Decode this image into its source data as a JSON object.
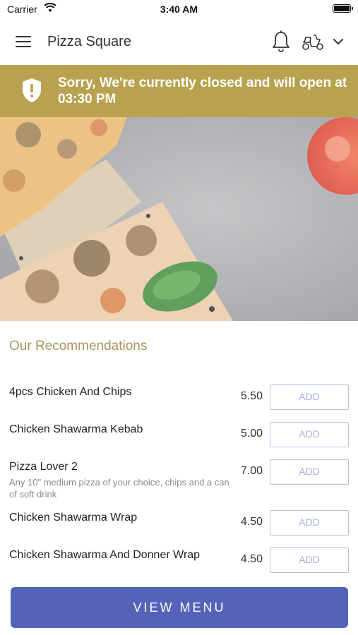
{
  "status_bar": {
    "carrier": "Carrier",
    "time": "3:40 AM"
  },
  "header": {
    "title": "Pizza Square",
    "icons": [
      "menu-icon",
      "bell-icon",
      "delivery-scooter-icon",
      "chevron-down-icon"
    ]
  },
  "banner": {
    "message": "Sorry, We're currently closed and will open at 03:30 PM",
    "icon": "shield-alert-icon",
    "color": "#b9a24f"
  },
  "recommendations": {
    "title": "Our Recommendations",
    "items": [
      {
        "name": "4pcs Chicken And Chips",
        "description": "",
        "price": "5.50",
        "add_label": "ADD"
      },
      {
        "name": "Chicken Shawarma Kebab",
        "description": "",
        "price": "5.00",
        "add_label": "ADD"
      },
      {
        "name": "Pizza Lover 2",
        "description": "Any 10\" medium pizza of your choice, chips and a can of soft drink",
        "price": "7.00",
        "add_label": "ADD"
      },
      {
        "name": "Chicken Shawarma Wrap",
        "description": "",
        "price": "4.50",
        "add_label": "ADD"
      },
      {
        "name": "Chicken Shawarma And Donner Wrap",
        "description": "",
        "price": "4.50",
        "add_label": "ADD"
      }
    ]
  },
  "footer": {
    "view_menu_label": "VIEW MENU",
    "accent": "#5562b9"
  }
}
